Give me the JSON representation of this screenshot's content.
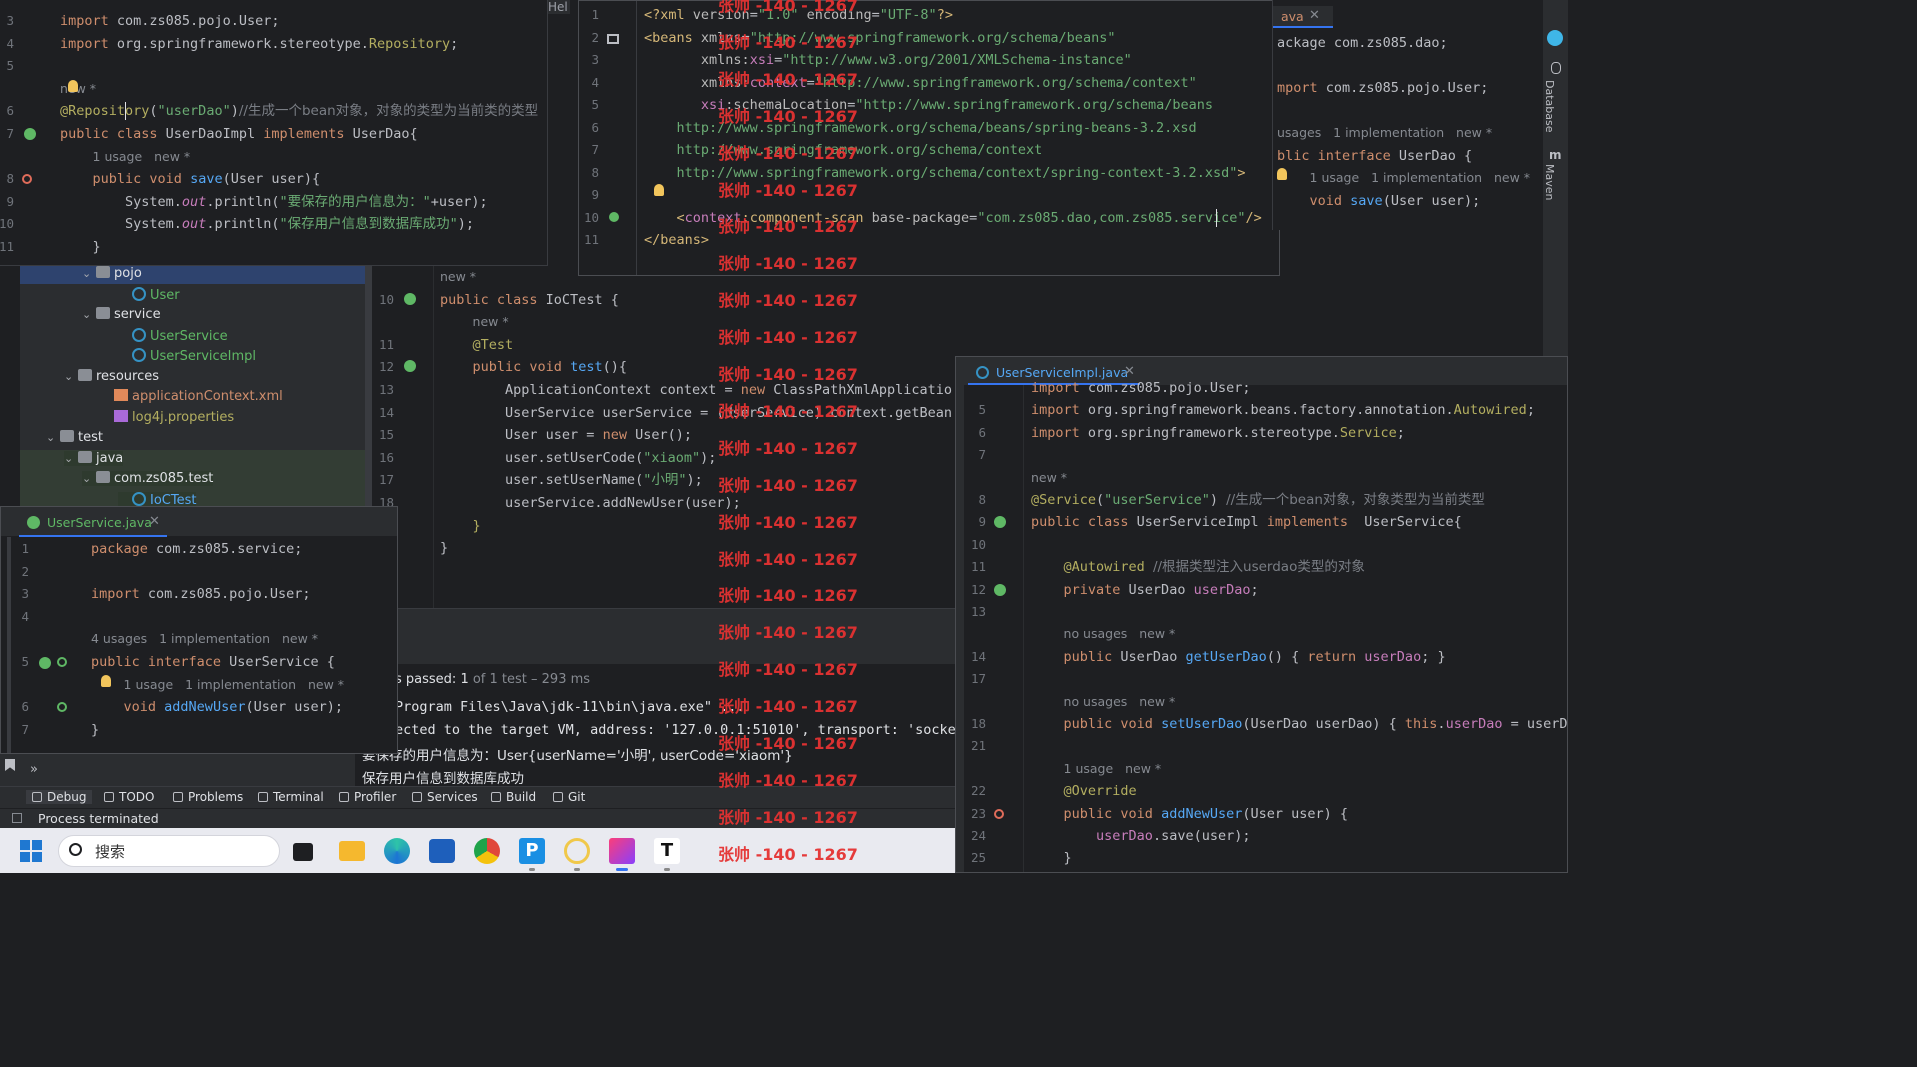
{
  "userdao_editor": {
    "lines": [
      {
        "n": "3",
        "html": "<span class='kw'>import</span> com.zs085.pojo.User;"
      },
      {
        "n": "4",
        "html": "<span class='kw'>import</span> org.springframework.stereotype.<span class='ann'>Repository</span>;"
      },
      {
        "n": "5",
        "html": ""
      },
      {
        "n": "",
        "html": "<span class='hint'>new *</span>"
      },
      {
        "n": "6",
        "html": "<span class='ann'>@Repository</span>(<span class='str'>\"userDao\"</span>)<span class='cm'>//生成一个bean对象，对象的类型为当前类的类型</span>"
      },
      {
        "n": "7",
        "html": "<span class='kw'>public class</span> UserDaoImpl <span class='kw'>implements</span> UserDao{"
      },
      {
        "n": "",
        "html": "    <span class='hint'>1 usage   new *</span>"
      },
      {
        "n": "8",
        "html": "    <span class='kw'>public void</span> <span class='fn'>save</span>(User user){"
      },
      {
        "n": "9",
        "html": "        System.<span class='fld it'>out</span>.println(<span class='str'>\"要保存的用户信息为：\"</span>+user);"
      },
      {
        "n": "10",
        "html": "        System.<span class='fld it'>out</span>.println(<span class='str'>\"保存用户信息到数据库成功\"</span>);"
      },
      {
        "n": "11",
        "html": "    }"
      }
    ]
  },
  "xml_editor": {
    "lines": [
      {
        "n": "1",
        "html": "<span class='xmlt'>&lt;?xml</span> <span class='xmla'>version</span>=<span class='str'>\"1.0\"</span> <span class='xmla'>encoding</span>=<span class='str'>\"UTF-8\"</span><span class='xmlt'>?&gt;</span>"
      },
      {
        "n": "2",
        "html": "<span class='xmlt'>&lt;beans</span> <span class='xmla'>xmlns</span>=<span class='str'>\"http://www.springframework.org/schema/beans\"</span>"
      },
      {
        "n": "3",
        "html": "       <span class='xmla'>xmlns:</span><span class='fld'>xsi</span>=<span class='str'>\"http://www.w3.org/2001/XMLSchema-instance\"</span>"
      },
      {
        "n": "4",
        "html": "       <span class='xmla'>xmlns:</span><span class='fld'>context</span>=<span class='str'>\"http://www.springframework.org/schema/context\"</span>"
      },
      {
        "n": "5",
        "html": "       <span class='fld'>xsi</span><span class='xmla'>:schemaLocation</span>=<span class='str'>\"http://www.springframework.org/schema/beans</span>"
      },
      {
        "n": "6",
        "html": "    <span class='str'>http://www.springframework.org/schema/beans/spring-beans-3.2.xsd</span>"
      },
      {
        "n": "7",
        "html": "    <span class='str'>http://www.springframework.org/schema/context</span>"
      },
      {
        "n": "8",
        "html": "    <span class='str'>http://www.springframework.org/schema/context/spring-context-3.2.xsd\"</span><span class='xmlt'>&gt;</span>"
      },
      {
        "n": "9",
        "html": ""
      },
      {
        "n": "10",
        "html": "    <span class='xmlt'>&lt;</span><span class='fld'>context</span><span class='xmlt'>:component-scan</span> <span class='xmla'>base-package</span>=<span class='str'>\"com.zs085.dao,com.zs085.service\"</span><span class='xmlt'>/&gt;</span>"
      },
      {
        "n": "11",
        "html": "<span class='xmlt'>&lt;/beans&gt;</span>"
      }
    ]
  },
  "right_top_editor": {
    "tab": "ava",
    "lines": [
      {
        "html": "ackage com.zs085.dao;"
      },
      {
        "html": ""
      },
      {
        "html": "<span class='kw'>mport</span> com.zs085.pojo.User;"
      },
      {
        "html": ""
      },
      {
        "html": "<span class='hint'>usages   1 implementation   new *</span>"
      },
      {
        "html": "<span class='kw'>blic interface</span> UserDao {"
      },
      {
        "html": "    <span class='hint'>1 usage   1 implementation   new *</span>"
      },
      {
        "html": "    <span class='kw'>void</span> <span class='fn'>save</span>(User user);"
      }
    ]
  },
  "right_sidebar": {
    "database": "Database",
    "maven": "Maven"
  },
  "project_tree": {
    "items": [
      {
        "label": "pojo",
        "kind": "folder",
        "indent": 3,
        "chev": "⌄"
      },
      {
        "label": "User",
        "kind": "class",
        "indent": 5
      },
      {
        "label": "service",
        "kind": "folder",
        "indent": 3,
        "chev": "⌄"
      },
      {
        "label": "UserService",
        "kind": "class",
        "indent": 5
      },
      {
        "label": "UserServiceImpl",
        "kind": "class",
        "indent": 5
      },
      {
        "label": "resources",
        "kind": "folder",
        "indent": 2,
        "chev": "⌄"
      },
      {
        "label": "applicationContext.xml",
        "kind": "xml",
        "indent": 4
      },
      {
        "label": "log4j.properties",
        "kind": "props",
        "indent": 4
      },
      {
        "label": "test",
        "kind": "folder",
        "indent": 1,
        "chev": "⌄"
      },
      {
        "label": "java",
        "kind": "folder",
        "indent": 2,
        "chev": "⌄"
      },
      {
        "label": "com.zs085.test",
        "kind": "folder",
        "indent": 3,
        "chev": "⌄"
      },
      {
        "label": "IoCTest",
        "kind": "class",
        "indent": 5
      }
    ]
  },
  "ioctest_editor": {
    "lines": [
      {
        "n": "",
        "html": "<span class='hint'>new *</span>"
      },
      {
        "n": "10",
        "html": "<span class='kw'>public class</span> IoCTest {"
      },
      {
        "n": "",
        "html": "    <span class='hint'>new *</span>"
      },
      {
        "n": "11",
        "html": "    <span class='ann'>@Test</span>"
      },
      {
        "n": "12",
        "html": "    <span class='kw'>public void</span> <span class='fn'>test</span>(){"
      },
      {
        "n": "13",
        "html": "        ApplicationContext context = <span class='kw'>new</span> ClassPathXmlApplicatio"
      },
      {
        "n": "14",
        "html": "        UserService userService = (UserService) context.getBean"
      },
      {
        "n": "15",
        "html": "        User user = <span class='kw'>new</span> User();"
      },
      {
        "n": "16",
        "html": "        user.setUserCode(<span class='str'>\"xiaom\"</span>);"
      },
      {
        "n": "17",
        "html": "        user.setUserName(<span class='str'>\"小明\"</span>);"
      },
      {
        "n": "18",
        "html": "        userService.addNewUser(user);"
      },
      {
        "n": "",
        "html": "    <span class='ann'>}</span>"
      },
      {
        "n": "",
        "html": "}"
      }
    ]
  },
  "console": {
    "passed_prefix": "s passed: ",
    "passed_count": "1",
    "passed_suffix": " of 1 test – 293 ms",
    "lines": [
      "Program Files\\Java\\jdk-11\\bin\\java.exe\" ...",
      "ected to the target VM, address: '127.0.0.1:51010', transport: 'socke",
      "要保存的用户信息为：User{userName='小明', userCode='xiaom'}",
      "保存用户信息到数据库成功"
    ]
  },
  "userservice_editor": {
    "tab": "UserService.java",
    "lines": [
      {
        "n": "1",
        "html": "<span class='kw'>package</span> com.zs085.service;"
      },
      {
        "n": "2",
        "html": ""
      },
      {
        "n": "3",
        "html": "<span class='kw'>import</span> com.zs085.pojo.User;"
      },
      {
        "n": "4",
        "html": ""
      },
      {
        "n": "",
        "html": "<span class='hint'>4 usages   1 implementation   new *</span>"
      },
      {
        "n": "5",
        "html": "<span class='kw'>public interface</span> UserService {"
      },
      {
        "n": "",
        "html": "    <span class='hint'>1 usage   1 implementation   new *</span>"
      },
      {
        "n": "6",
        "html": "    <span class='kw'>void</span> <span class='fn'>addNewUser</span>(User user);"
      },
      {
        "n": "7",
        "html": "}"
      }
    ]
  },
  "impl_editor": {
    "tab": "UserServiceImpl.java",
    "lines": [
      {
        "n": "",
        "html": "<span class='kw'>import</span> com.zs085.pojo.User;"
      },
      {
        "n": "5",
        "html": "<span class='kw'>import</span> org.springframework.beans.factory.annotation.<span class='ann'>Autowired</span>;"
      },
      {
        "n": "6",
        "html": "<span class='kw'>import</span> org.springframework.stereotype.<span class='ann'>Service</span>;"
      },
      {
        "n": "7",
        "html": ""
      },
      {
        "n": "",
        "html": "<span class='hint'>new *</span>"
      },
      {
        "n": "8",
        "html": "<span class='ann'>@Service</span>(<span class='str'>\"userService\"</span>) <span class='cm'>//生成一个bean对象，对象类型为当前类型</span>"
      },
      {
        "n": "9",
        "html": "<span class='kw'>public class</span> UserServiceImpl <span class='kw'>implements</span>  UserService{"
      },
      {
        "n": "10",
        "html": ""
      },
      {
        "n": "11",
        "html": "    <span class='ann'>@Autowired</span> <span class='cm'>//根据类型注入userdao类型的对象</span>"
      },
      {
        "n": "12",
        "html": "    <span class='kw'>private</span> UserDao <span class='fld'>userDao</span>;"
      },
      {
        "n": "13",
        "html": ""
      },
      {
        "n": "",
        "html": "    <span class='hint'>no usages   new *</span>"
      },
      {
        "n": "14",
        "html": "    <span class='kw'>public</span> UserDao <span class='fn'>getUserDao</span>() { <span class='kw'>return</span> <span class='fld'>userDao</span>; }"
      },
      {
        "n": "17",
        "html": ""
      },
      {
        "n": "",
        "html": "    <span class='hint'>no usages   new *</span>"
      },
      {
        "n": "18",
        "html": "    <span class='kw'>public void</span> <span class='fn'>setUserDao</span>(UserDao userDao) { <span class='kw'>this</span>.<span class='fld'>userDao</span> = userD"
      },
      {
        "n": "21",
        "html": ""
      },
      {
        "n": "",
        "html": "    <span class='hint'>1 usage   new *</span>"
      },
      {
        "n": "22",
        "html": "    <span class='ann'>@Override</span>"
      },
      {
        "n": "23",
        "html": "    <span class='kw'>public void</span> <span class='fn'>addNewUser</span>(User user) {"
      },
      {
        "n": "24",
        "html": "        <span class='fld'>userDao</span>.save(user);"
      },
      {
        "n": "25",
        "html": "    }"
      }
    ]
  },
  "toolwindow_bar": {
    "items": [
      "Debug",
      "TODO",
      "Problems",
      "Terminal",
      "Profiler",
      "Services",
      "Build",
      "Git"
    ]
  },
  "status": {
    "text": "Process terminated"
  },
  "taskbar": {
    "search_placeholder": "搜索"
  },
  "watermark": {
    "text": "张帅 -140 - 1267"
  },
  "fragments": {
    "left_cut": "085",
    "hel": "Hel",
    "cursor_misc": "»"
  }
}
